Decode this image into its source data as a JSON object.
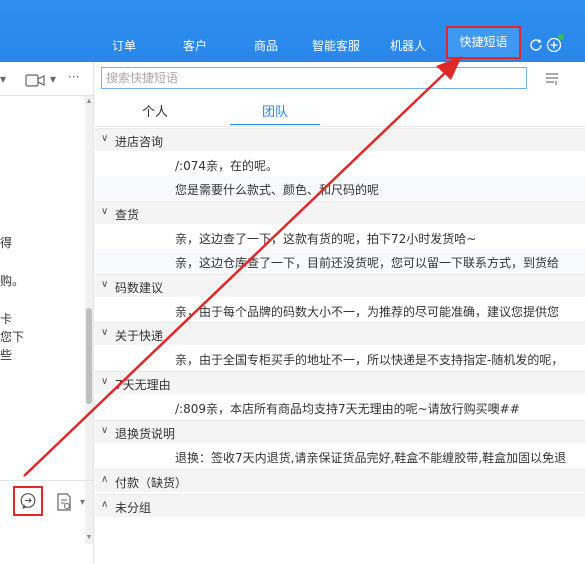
{
  "nav": {
    "items": [
      "订单",
      "客户",
      "商品",
      "智能客服",
      "机器人"
    ],
    "active": "快捷短语"
  },
  "search": {
    "placeholder": "搜索快捷短语"
  },
  "tabs": [
    "个人",
    "团队"
  ],
  "groups": [
    {
      "name": "进店咨询",
      "expanded": true,
      "phrases": [
        "/:074亲，在的呢。",
        "您是需要什么款式、颜色、和尺码的呢"
      ]
    },
    {
      "name": "查货",
      "expanded": true,
      "phrases": [
        "亲，这边查了一下，这款有货的呢，拍下72小时发货哈~",
        "亲，这边仓库查了一下，目前还没货呢，您可以留一下联系方式，到货给"
      ]
    },
    {
      "name": "码数建议",
      "expanded": true,
      "phrases": [
        "亲，由于每个品牌的码数大小不一，为推荐的尽可能准确，建议您提供您"
      ]
    },
    {
      "name": "关于快递",
      "expanded": true,
      "phrases": [
        "亲，由于全国专柜买手的地址不一，所以快递是不支持指定-随机发的呢，"
      ]
    },
    {
      "name": "7天无理由",
      "expanded": true,
      "phrases": [
        "/:809亲，本店所有商品均支持7天无理由的呢~请放行购买噢##"
      ]
    },
    {
      "name": "退换货说明",
      "expanded": true,
      "phrases": [
        "退换：签收7天内退货,请亲保证货品完好,鞋盒不能缠胶带,鞋盒加固以免退"
      ]
    },
    {
      "name": "付款（缺货）",
      "expanded": false,
      "phrases": []
    },
    {
      "name": "未分组",
      "expanded": false,
      "phrases": []
    }
  ],
  "left_fragments": [
    "得",
    "购。",
    "卡",
    "您下",
    "些"
  ],
  "left_toolbar": {
    "chevron": "▾",
    "video_chevron": "▾",
    "more": "···"
  },
  "colors": {
    "brand_blue": "#2a86ea",
    "highlight_red": "#e02828",
    "online_green": "#35c24a"
  },
  "icons": [
    "refresh-icon",
    "add-icon",
    "menu-icon",
    "chat-icon",
    "notes-icon",
    "video-icon"
  ]
}
